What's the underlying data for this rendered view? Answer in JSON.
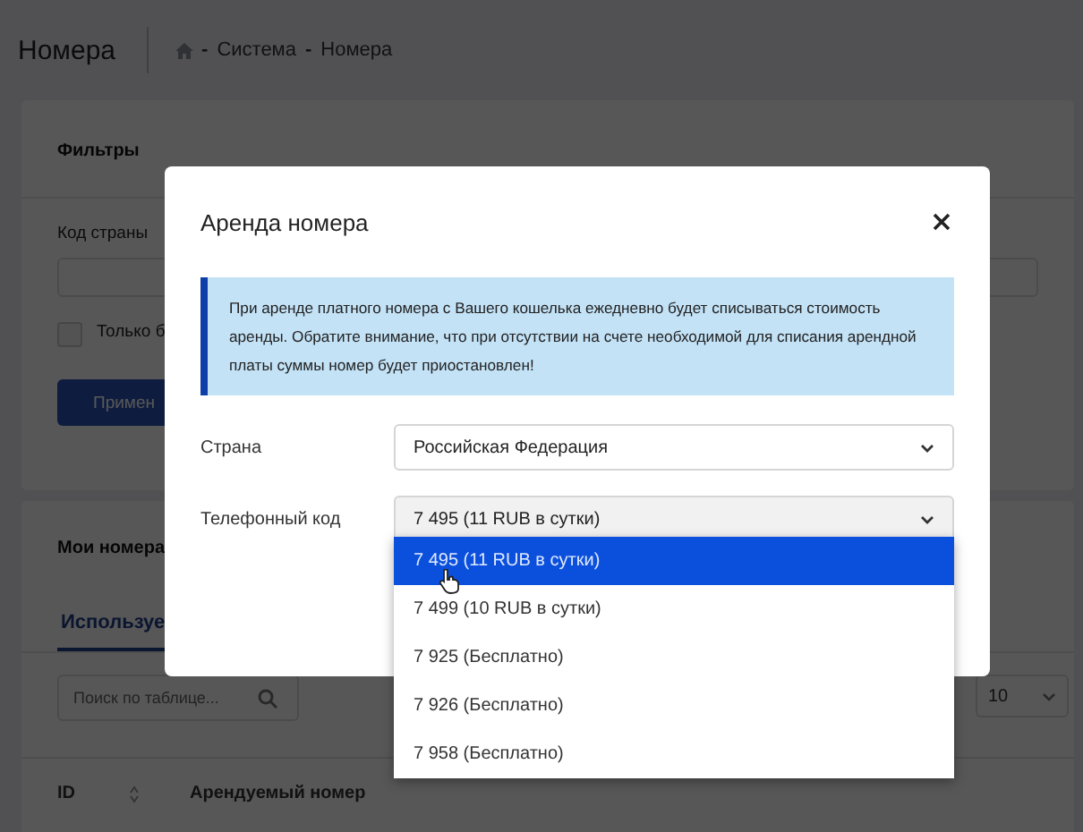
{
  "page": {
    "title": "Номера",
    "breadcrumb_separator": "-",
    "breadcrumb": [
      "Система",
      "Номера"
    ]
  },
  "filters": {
    "title": "Фильтры",
    "country_code_label": "Код страны",
    "only_label": "Только б",
    "checked": false,
    "apply_button": "Примен"
  },
  "my_numbers": {
    "title": "Мои номера",
    "tabs": [
      {
        "label": "Используе",
        "selected": true
      }
    ],
    "search": {
      "placeholder": "Поиск по таблице..."
    },
    "page_size": "10",
    "columns": [
      "ID",
      "Арендуемый номер"
    ]
  },
  "modal": {
    "title": "Аренда номера",
    "notice": "При аренде платного номера с Вашего кошелька ежедневно будет списываться стоимость аренды. Обратите внимание, что при отсутствии на счете необходимой для списания арендной платы суммы номер будет приостановлен!",
    "fields": [
      {
        "label": "Страна",
        "value": "Российская Федерация",
        "open": false
      },
      {
        "label": "Телефонный код",
        "value": "7 495 (11 RUB в сутки)",
        "open": true
      }
    ],
    "options": [
      {
        "label": "7 495 (11 RUB в сутки)",
        "selected": true
      },
      {
        "label": "7 499 (10 RUB в сутки)",
        "selected": false
      },
      {
        "label": "7 925 (Бесплатно)",
        "selected": false
      },
      {
        "label": "7 926 (Бесплатно)",
        "selected": false
      },
      {
        "label": "7 958 (Бесплатно)",
        "selected": false
      }
    ]
  }
}
